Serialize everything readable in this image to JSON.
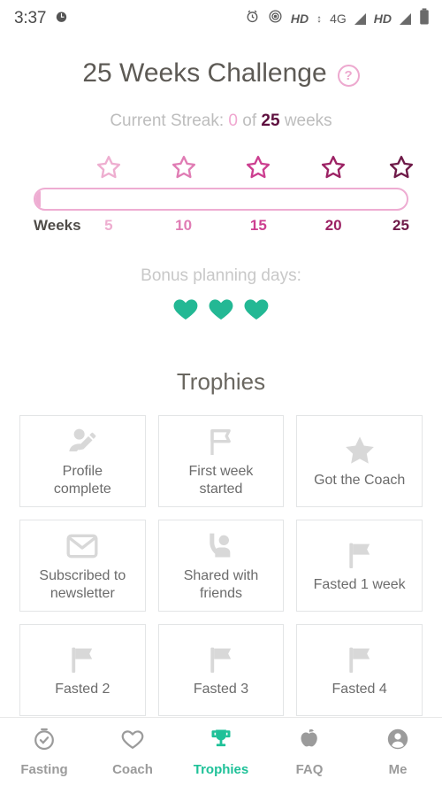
{
  "status_bar": {
    "time": "3:37",
    "left_icons": [
      "alarm-clock-icon"
    ],
    "alarm_icon": "alarm-icon",
    "cast_icon": "cast-icon",
    "hd_label_1": "HD",
    "network_label": "4G",
    "updown_glyph": "↕",
    "hd_label_2": "HD",
    "battery_icon": "battery-icon"
  },
  "header": {
    "title": "25 Weeks Challenge",
    "help_glyph": "?",
    "help_name": "help-icon"
  },
  "streak": {
    "prefix": "Current Streak: ",
    "current": "0",
    "middle": " of ",
    "total": "25",
    "suffix": " weeks"
  },
  "progress": {
    "weeks_label": "Weeks",
    "fill_percent": 1.5,
    "milestones": [
      {
        "value": "5",
        "pos": 20,
        "color": "#eeaed0"
      },
      {
        "value": "10",
        "pos": 40,
        "color": "#e07cb4"
      },
      {
        "value": "15",
        "pos": 60,
        "color": "#cc3f90"
      },
      {
        "value": "20",
        "pos": 80,
        "color": "#9c2264"
      },
      {
        "value": "25",
        "pos": 98,
        "color": "#6e1a48"
      }
    ],
    "track_color": "#eeacd2",
    "fill_color": "#eeacd2"
  },
  "bonus": {
    "label": "Bonus planning days:",
    "heart_count": 3,
    "heart_color": "#23b894"
  },
  "trophies": {
    "title": "Trophies",
    "items": [
      {
        "label": "Profile\ncomplete",
        "icon": "person-edit-icon"
      },
      {
        "label": "First week\nstarted",
        "icon": "flag-outline-icon"
      },
      {
        "label": "Got the Coach",
        "icon": "star-filled-icon"
      },
      {
        "label": "Subscribed to\nnewsletter",
        "icon": "envelope-icon"
      },
      {
        "label": "Shared with\nfriends",
        "icon": "person-share-icon"
      },
      {
        "label": "Fasted 1 week",
        "icon": "flag-filled-icon"
      },
      {
        "label": "Fasted 2",
        "icon": "flag-filled-icon"
      },
      {
        "label": "Fasted 3",
        "icon": "flag-filled-icon"
      },
      {
        "label": "Fasted 4",
        "icon": "flag-filled-icon"
      }
    ],
    "icon_color": "#d8d8d8"
  },
  "nav": {
    "active_color": "#1ec198",
    "inactive_color": "#9b9b9b",
    "items": [
      {
        "label": "Fasting",
        "icon": "timer-icon",
        "active": false
      },
      {
        "label": "Coach",
        "icon": "heart-icon",
        "active": false
      },
      {
        "label": "Trophies",
        "icon": "trophy-icon",
        "active": true
      },
      {
        "label": "FAQ",
        "icon": "apple-icon",
        "active": false
      },
      {
        "label": "Me",
        "icon": "person-icon",
        "active": false
      }
    ]
  }
}
